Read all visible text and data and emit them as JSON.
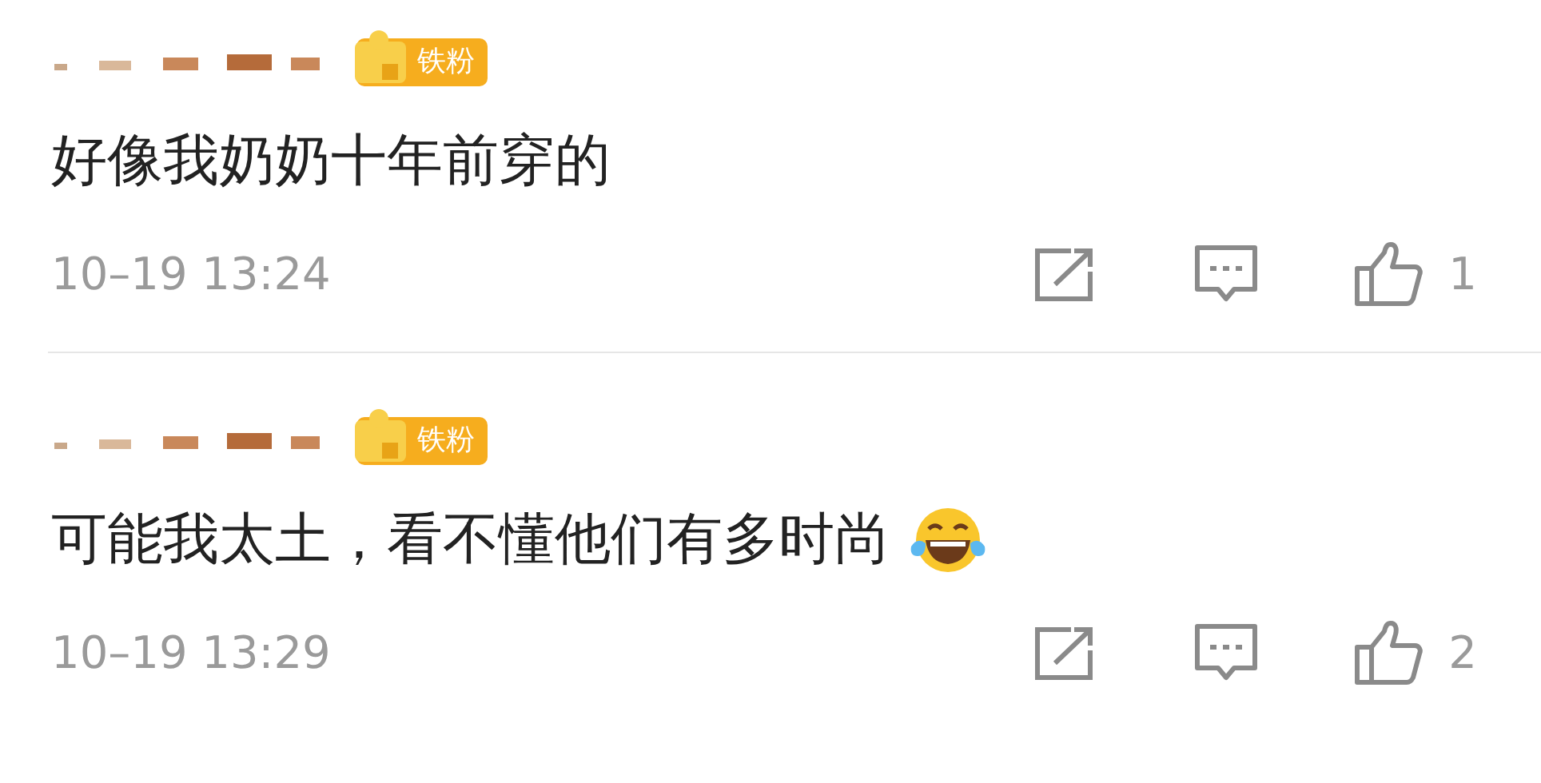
{
  "comments": [
    {
      "badge": "铁粉",
      "text": "好像我奶奶十年前穿的",
      "emoji": false,
      "time": "10–19 13:24",
      "likes": "1"
    },
    {
      "badge": "铁粉",
      "text": "可能我太土，看不懂他们有多时尚",
      "emoji": true,
      "time": "10–19 13:29",
      "likes": "2"
    }
  ]
}
